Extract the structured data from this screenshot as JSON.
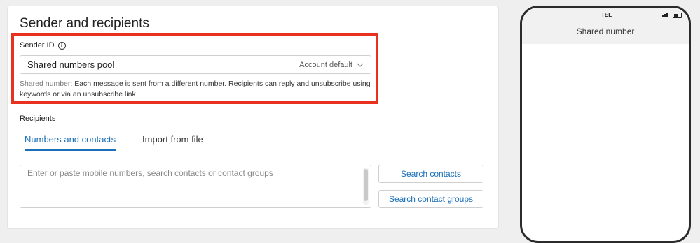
{
  "section": {
    "title": "Sender and recipients",
    "sender_id_label": "Sender ID",
    "sender_select_value": "Shared numbers pool",
    "sender_select_tag": "Account default",
    "help_prefix": "Shared number:",
    "help_text": " Each message is sent from a different number. Recipients can reply and unsubscribe using keywords or via an unsubscribe link.",
    "recipients_label": "Recipients",
    "tabs": [
      {
        "label": "Numbers and contacts",
        "active": true
      },
      {
        "label": "Import from file",
        "active": false
      }
    ],
    "numbers_placeholder": "Enter or paste mobile numbers, search contacts or contact groups",
    "search_contacts_label": "Search contacts",
    "search_groups_label": "Search contact groups"
  },
  "phone": {
    "carrier": "TEL",
    "title": "Shared number"
  },
  "colors": {
    "accent": "#1a6fb8",
    "highlight": "#e8321f"
  }
}
